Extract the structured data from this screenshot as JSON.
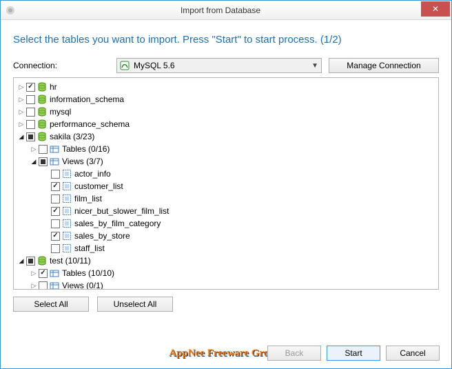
{
  "window": {
    "title": "Import from Database",
    "close_glyph": "✕"
  },
  "instruction": "Select the tables you want to import. Press \"Start\" to start process. (1/2)",
  "connection": {
    "label": "Connection:",
    "selected": "MySQL 5.6",
    "manage_btn": "Manage Connection"
  },
  "tree": {
    "nodes": [
      {
        "depth": 0,
        "exp": "closed",
        "check": "checked",
        "icon": "db",
        "label": "hr"
      },
      {
        "depth": 0,
        "exp": "closed",
        "check": "off",
        "icon": "db",
        "label": "information_schema"
      },
      {
        "depth": 0,
        "exp": "closed",
        "check": "off",
        "icon": "db",
        "label": "mysql"
      },
      {
        "depth": 0,
        "exp": "closed",
        "check": "off",
        "icon": "db",
        "label": "performance_schema"
      },
      {
        "depth": 0,
        "exp": "open",
        "check": "mixed",
        "icon": "db",
        "label": "sakila (3/23)"
      },
      {
        "depth": 1,
        "exp": "closed",
        "check": "off",
        "icon": "folder",
        "label": "Tables (0/16)"
      },
      {
        "depth": 1,
        "exp": "open",
        "check": "mixed",
        "icon": "folder",
        "label": "Views (3/7)"
      },
      {
        "depth": 2,
        "exp": "none",
        "check": "off",
        "icon": "view",
        "label": "actor_info"
      },
      {
        "depth": 2,
        "exp": "none",
        "check": "checked",
        "icon": "view",
        "label": "customer_list"
      },
      {
        "depth": 2,
        "exp": "none",
        "check": "off",
        "icon": "view",
        "label": "film_list"
      },
      {
        "depth": 2,
        "exp": "none",
        "check": "checked",
        "icon": "view",
        "label": "nicer_but_slower_film_list"
      },
      {
        "depth": 2,
        "exp": "none",
        "check": "off",
        "icon": "view",
        "label": "sales_by_film_category"
      },
      {
        "depth": 2,
        "exp": "none",
        "check": "checked",
        "icon": "view",
        "label": "sales_by_store"
      },
      {
        "depth": 2,
        "exp": "none",
        "check": "off",
        "icon": "view",
        "label": "staff_list"
      },
      {
        "depth": 0,
        "exp": "open",
        "check": "mixed",
        "icon": "db",
        "label": "test (10/11)"
      },
      {
        "depth": 1,
        "exp": "closed",
        "check": "checked",
        "icon": "folder",
        "label": "Tables (10/10)"
      },
      {
        "depth": 1,
        "exp": "closed",
        "check": "off",
        "icon": "folder",
        "label": "Views (0/1)"
      }
    ]
  },
  "buttons": {
    "select_all": "Select All",
    "unselect_all": "Unselect All",
    "back": "Back",
    "start": "Start",
    "cancel": "Cancel"
  },
  "watermark": "AppNee Freeware Group."
}
